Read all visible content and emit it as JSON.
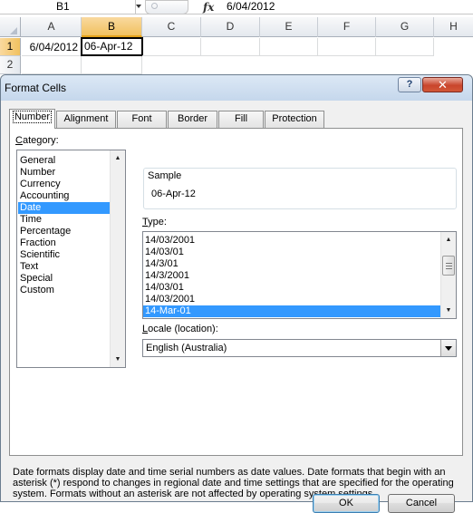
{
  "spreadsheet": {
    "name_box": "B1",
    "fx_label": "fx",
    "formula_value": "6/04/2012",
    "columns": [
      "A",
      "B",
      "C",
      "D",
      "E",
      "F",
      "G",
      "H"
    ],
    "rows": [
      "1",
      "2"
    ],
    "cells": {
      "A1": "6/04/2012",
      "B1": "06-Apr-12"
    }
  },
  "dialog": {
    "title": "Format Cells",
    "help_label": "?",
    "close_label": "✕",
    "tabs": [
      "Number",
      "Alignment",
      "Font",
      "Border",
      "Fill",
      "Protection"
    ],
    "active_tab": "Number",
    "category_label_u": "C",
    "category_label_rest": "ategory:",
    "categories": [
      "General",
      "Number",
      "Currency",
      "Accounting",
      "Date",
      "Time",
      "Percentage",
      "Fraction",
      "Scientific",
      "Text",
      "Special",
      "Custom"
    ],
    "selected_category": "Date",
    "sample_label": "Sample",
    "sample_value": "06-Apr-12",
    "type_label_u": "T",
    "type_label_rest": "ype:",
    "types": [
      "14/03/2001",
      "14/03/01",
      "14/3/01",
      "14/3/2001",
      "14/03/01",
      "14/03/2001",
      "14-Mar-01"
    ],
    "selected_type": "14-Mar-01",
    "locale_label_u": "L",
    "locale_label_rest": "ocale (location):",
    "locale_value": "English (Australia)",
    "description": "Date formats display date and time serial numbers as date values.  Date formats that begin with an asterisk (*) respond to changes in regional date and time settings that are specified for the operating system. Formats without an asterisk are not affected by operating system settings.",
    "ok_label": "OK",
    "cancel_label": "Cancel"
  },
  "colors": {
    "selection": "#3399ff",
    "title_bar": "#c5d7ec",
    "close_button": "#c9452c",
    "header_highlight": "#f1c15f"
  }
}
